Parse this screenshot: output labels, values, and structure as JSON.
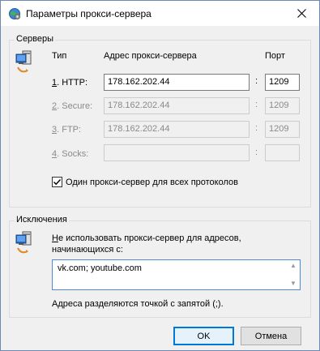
{
  "window": {
    "title": "Параметры прокси-сервера"
  },
  "servers": {
    "group_label": "Серверы",
    "col_type": "Тип",
    "col_address": "Адрес прокси-сервера",
    "col_port": "Порт",
    "rows": [
      {
        "num": "1",
        "label": ". HTTP:",
        "address": "178.162.202.44",
        "port": "1209",
        "enabled": true
      },
      {
        "num": "2",
        "label": ". Secure:",
        "address": "178.162.202.44",
        "port": "1209",
        "enabled": false
      },
      {
        "num": "3",
        "label": ". FTP:",
        "address": "178.162.202.44",
        "port": "1209",
        "enabled": false
      },
      {
        "num": "4",
        "label": ". Socks:",
        "address": "",
        "port": "",
        "enabled": false
      }
    ],
    "same_proxy_label": "Один прокси-сервер для всех протоколов",
    "same_proxy_checked": true
  },
  "exceptions": {
    "group_label": "Исключения",
    "description_line1_u": "Н",
    "description_line1": "е использовать прокси-сервер для адресов,",
    "description_line2": "начинающихся с:",
    "value": "vk.com; youtube.com",
    "hint": "Адреса разделяются точкой с запятой (;)."
  },
  "buttons": {
    "ok": "OK",
    "cancel": "Отмена"
  },
  "colors": {
    "accent": "#0078d7",
    "border": "#7a7a7a",
    "dialog_bg": "#f0f0f0"
  },
  "icons": [
    "globe-settings-icon",
    "close-icon",
    "network-computer-icon",
    "checkmark-icon"
  ]
}
